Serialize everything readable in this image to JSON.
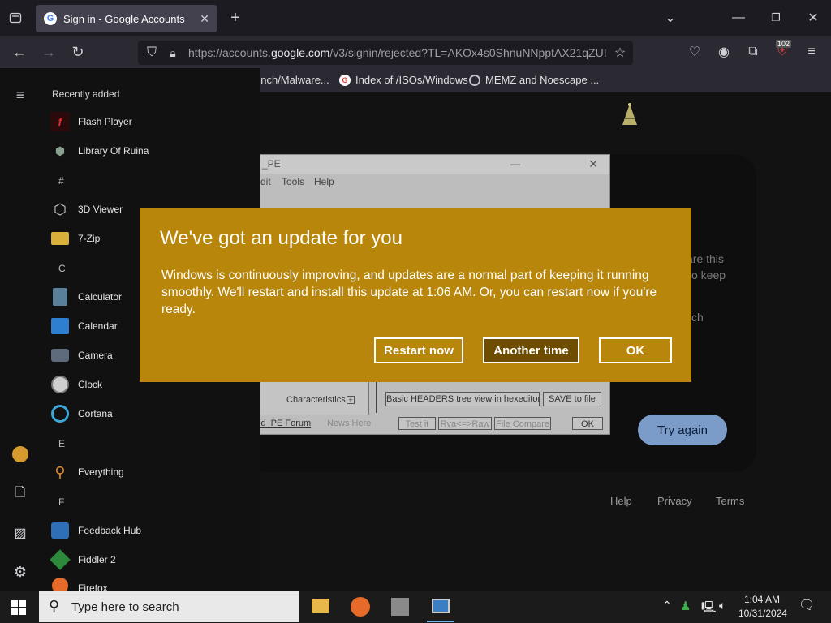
{
  "browser": {
    "tab_title": "Sign in - Google Accounts",
    "url_prefix": "https://accounts.",
    "url_domain": "google.com",
    "url_rest": "/v3/signin/rejected?TL=AKOx4s0ShnuNNpptAX21qZUI",
    "bookmarks": [
      "ench/Malware...",
      "Index of /ISOs/Windows",
      "MEMZ and Noescape ..."
    ],
    "badge": "102"
  },
  "page": {
    "partial_lines": [
      "are this",
      "o keep",
      "ch"
    ],
    "try_again": "Try again",
    "footer": [
      "Help",
      "Privacy",
      "Terms"
    ]
  },
  "pe_window": {
    "title": "_PE",
    "menu": [
      "dit",
      "Tools",
      "Help"
    ],
    "field_label": "Characteristics",
    "btn_tree": "Basic HEADERS tree view in hexeditor",
    "btn_save": "SAVE to file",
    "link": "id_PE Forum",
    "news": "News Here",
    "btn_test": "Test it",
    "btn_rva": "Rva<=>Raw",
    "btn_compare": "File Compare",
    "btn_ok": "OK"
  },
  "start_menu": {
    "header": "Recently added",
    "items": [
      {
        "label": "Flash Player",
        "icon": "flash-icon"
      },
      {
        "label": "Library Of Ruina",
        "icon": "ruina-icon"
      },
      {
        "letter": "#"
      },
      {
        "label": "3D Viewer",
        "icon": "cube-icon"
      },
      {
        "label": "7-Zip",
        "icon": "folder-icon"
      },
      {
        "letter": "C"
      },
      {
        "label": "Calculator",
        "icon": "calculator-icon"
      },
      {
        "label": "Calendar",
        "icon": "calendar-icon"
      },
      {
        "label": "Camera",
        "icon": "camera-icon"
      },
      {
        "label": "Clock",
        "icon": "clock-icon"
      },
      {
        "label": "Cortana",
        "icon": "cortana-icon"
      },
      {
        "letter": "E"
      },
      {
        "label": "Everything",
        "icon": "search-icon"
      },
      {
        "letter": "F"
      },
      {
        "label": "Feedback Hub",
        "icon": "feedback-icon"
      },
      {
        "label": "Fiddler 2",
        "icon": "fiddler-icon"
      },
      {
        "label": "Firefox",
        "icon": "firefox-icon"
      }
    ]
  },
  "dialog": {
    "title": "We've got an update for you",
    "body": "Windows is continuously improving, and updates are a normal part of keeping it running smoothly. We'll restart and install this update at 1:06 AM. Or, you can restart now if you're ready.",
    "btn_restart": "Restart now",
    "btn_another": "Another time",
    "btn_ok": "OK"
  },
  "taskbar": {
    "search_placeholder": "Type here to search",
    "time": "1:04 AM",
    "date": "10/31/2024"
  },
  "colors": {
    "dialog_bg": "#b8860b",
    "accent_button": "#7b9cc8"
  }
}
